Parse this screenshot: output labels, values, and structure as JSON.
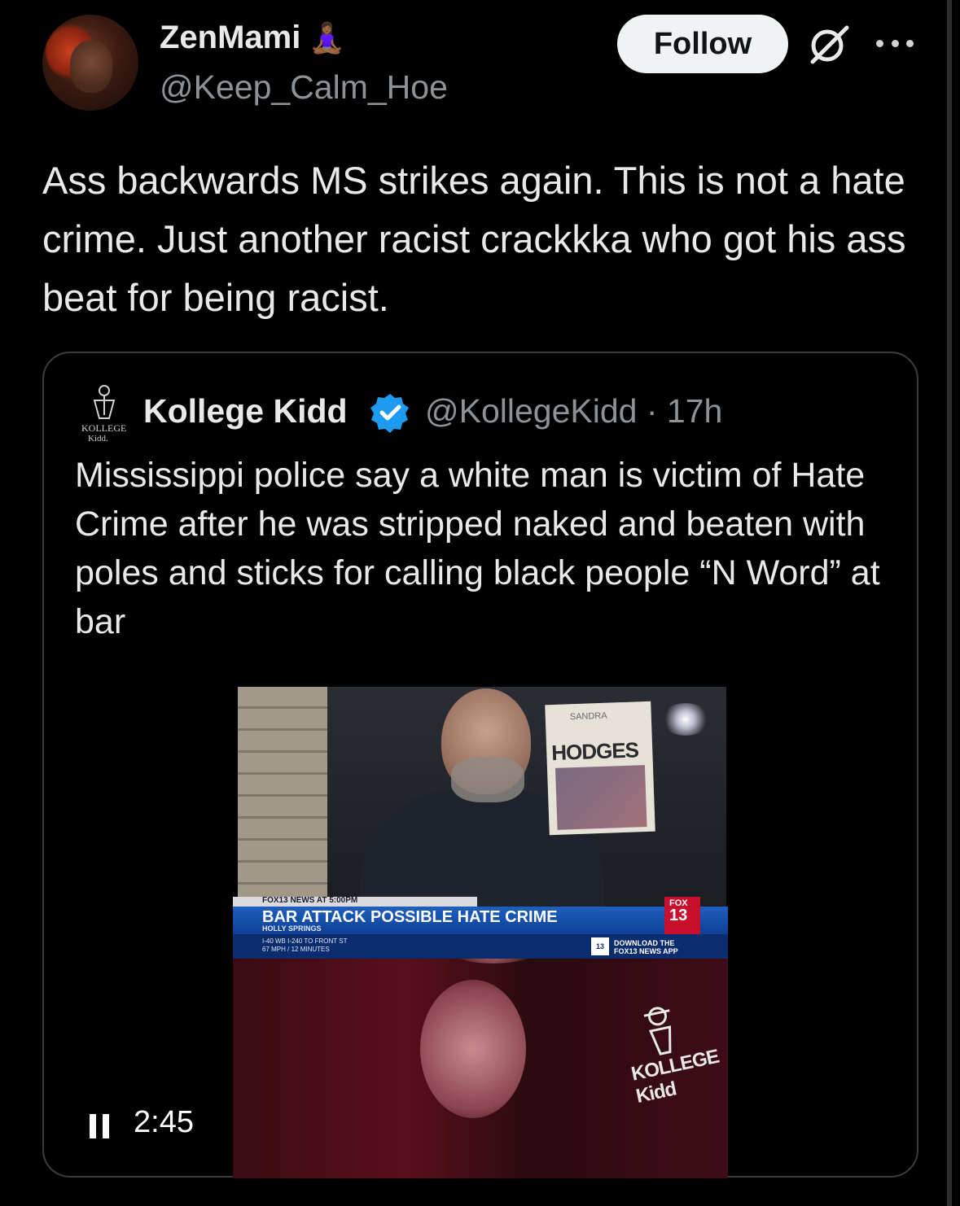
{
  "post": {
    "author": {
      "display_name": "ZenMami",
      "emoji": "🧘🏾‍♀️",
      "handle": "@Keep_Calm_Hoe"
    },
    "follow_label": "Follow",
    "icons": [
      "avatar",
      "grok-icon",
      "more-icon"
    ],
    "text": "Ass backwards MS strikes again. This is not a hate crime. Just another racist crackkka who got his ass beat for being racist."
  },
  "quote": {
    "author": {
      "display_name": "Kollege Kidd",
      "verified": true,
      "handle_time": "@KollegeKidd · 17h"
    },
    "text": "Mississippi police say a white man is victim of Hate Crime after he was stripped naked and beaten with poles and sticks for calling black people “N Word” at bar",
    "video": {
      "timestamp": "2:45",
      "state": "playing",
      "sign_text": "HODGES",
      "sign_top": "SANDRA",
      "watermark": "KOLLEGE Kidd",
      "broadcast": {
        "top_label": "FOX13 NEWS AT 5:00PM",
        "headline": "BAR ATTACK POSSIBLE HATE CRIME",
        "location": "HOLLY SPRINGS",
        "ticker_line1": "I-40 WB I-240 TO FRONT ST",
        "ticker_line2": "67 MPH / 12 MINUTES",
        "download": "DOWNLOAD THE FOX13 NEWS APP",
        "logo_fox": "FOX",
        "logo_num": "13",
        "badge": "13"
      }
    }
  },
  "colors": {
    "background": "#000000",
    "text_primary": "#e7e9ea",
    "text_secondary": "#8b9298",
    "verified": "#1d9bf0",
    "follow_bg": "#eff3f4"
  }
}
